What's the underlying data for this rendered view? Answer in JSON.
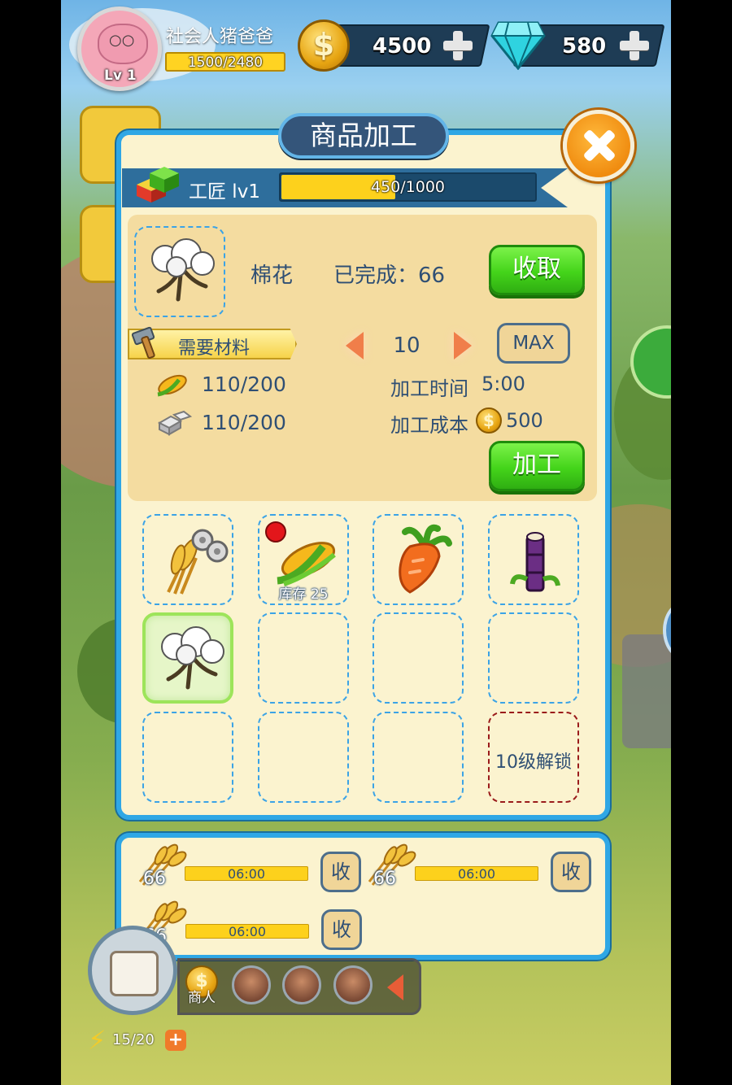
{
  "hud": {
    "player_name": "社会人猪爸爸",
    "level_label": "Lv 1",
    "xp_text": "1500/2480",
    "gold": "4500",
    "gems": "580",
    "coin_symbol": "$"
  },
  "dialog": {
    "title": "商品加工",
    "worker_label": "工匠 lv1",
    "worker_progress_text": "450/1000",
    "worker_progress_fraction": 0.45,
    "current_item": {
      "name": "棉花",
      "done_text": "已完成：66"
    },
    "collect_label": "收取",
    "materials_label": "需要材料",
    "quantity": "10",
    "max_label": "MAX",
    "materials": [
      {
        "icon": "corn-icon",
        "amount": "110/200"
      },
      {
        "icon": "stone-icon",
        "amount": "110/200"
      }
    ],
    "process_time_label": "加工时间",
    "process_time_value": "5:00",
    "process_cost_label": "加工成本",
    "process_cost_value": "500",
    "process_label": "加工",
    "grid": [
      {
        "icon": "wheat-gear-icon",
        "stock": "",
        "state": "normal"
      },
      {
        "icon": "corn-icon",
        "stock": "库存 25",
        "state": "normal",
        "alert": true
      },
      {
        "icon": "carrot-icon",
        "stock": "",
        "state": "normal"
      },
      {
        "icon": "sugarcane-icon",
        "stock": "",
        "state": "normal"
      },
      {
        "icon": "cotton-icon",
        "stock": "",
        "state": "selected"
      },
      {
        "icon": "",
        "stock": "",
        "state": "empty"
      },
      {
        "icon": "",
        "stock": "",
        "state": "empty"
      },
      {
        "icon": "",
        "stock": "",
        "state": "empty"
      },
      {
        "icon": "",
        "stock": "",
        "state": "empty"
      },
      {
        "icon": "",
        "stock": "",
        "state": "empty"
      },
      {
        "icon": "",
        "stock": "",
        "state": "empty"
      },
      {
        "icon": "",
        "stock": "",
        "state": "locked",
        "lock_text": "10级解锁"
      }
    ]
  },
  "queue": {
    "items": [
      {
        "icon": "wheat-icon",
        "count": "66",
        "time": "06:00",
        "button": "收"
      },
      {
        "icon": "wheat-icon",
        "count": "66",
        "time": "06:00",
        "button": "收"
      },
      {
        "icon": "wheat-icon",
        "count": "66",
        "time": "06:00",
        "button": "收"
      }
    ]
  },
  "bottom": {
    "merchant_label": "商人",
    "energy_text": "15/20"
  }
}
